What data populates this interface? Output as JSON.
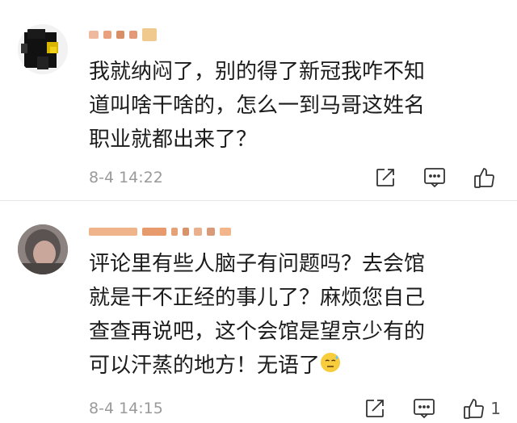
{
  "comments": [
    {
      "lines": [
        "我就纳闷了，别的得了新冠我咋不知",
        "道叫啥干啥的，怎么一到马哥这姓名",
        "职业就都出来了？"
      ],
      "time": "8-4 14:22",
      "like_count": "",
      "icons": [
        "share-icon",
        "comment-icon",
        "like-icon"
      ]
    },
    {
      "lines": [
        "评论里有些人脑子有问题吗？去会馆",
        "就是干不正经的事儿了？麻烦您自己",
        "查查再说吧，这个会馆是望京少有的",
        "可以汗蒸的地方！无语了"
      ],
      "time": "8-4 14:15",
      "like_count": "1",
      "icons": [
        "share-icon",
        "comment-icon",
        "like-icon"
      ]
    }
  ],
  "colors": {
    "text": "#1b1b1b",
    "meta": "#9a9a9a",
    "divider": "#e6e6e6"
  }
}
